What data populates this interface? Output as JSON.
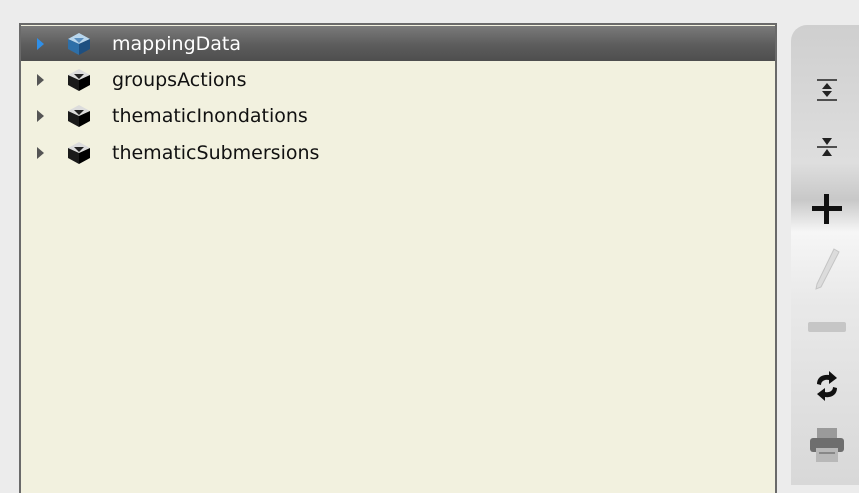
{
  "tree": {
    "items": [
      {
        "label": "mappingData",
        "icon": "database-icon",
        "selected": true
      },
      {
        "label": "groupsActions",
        "icon": "database-icon",
        "selected": false
      },
      {
        "label": "thematicInondations",
        "icon": "database-icon",
        "selected": false
      },
      {
        "label": "thematicSubmersions",
        "icon": "database-icon",
        "selected": false
      }
    ]
  },
  "toolbar": {
    "tools": [
      {
        "name": "expand-all-icon"
      },
      {
        "name": "collapse-all-icon"
      },
      {
        "name": "add-icon"
      },
      {
        "name": "edit-icon",
        "disabled": true
      },
      {
        "name": "remove-icon",
        "disabled": true
      },
      {
        "name": "refresh-icon"
      },
      {
        "name": "print-icon"
      }
    ]
  },
  "colors": {
    "tree_background": "#f2f1df",
    "selection": "#5c5c5c",
    "expander_selected": "#2f8fe8"
  }
}
